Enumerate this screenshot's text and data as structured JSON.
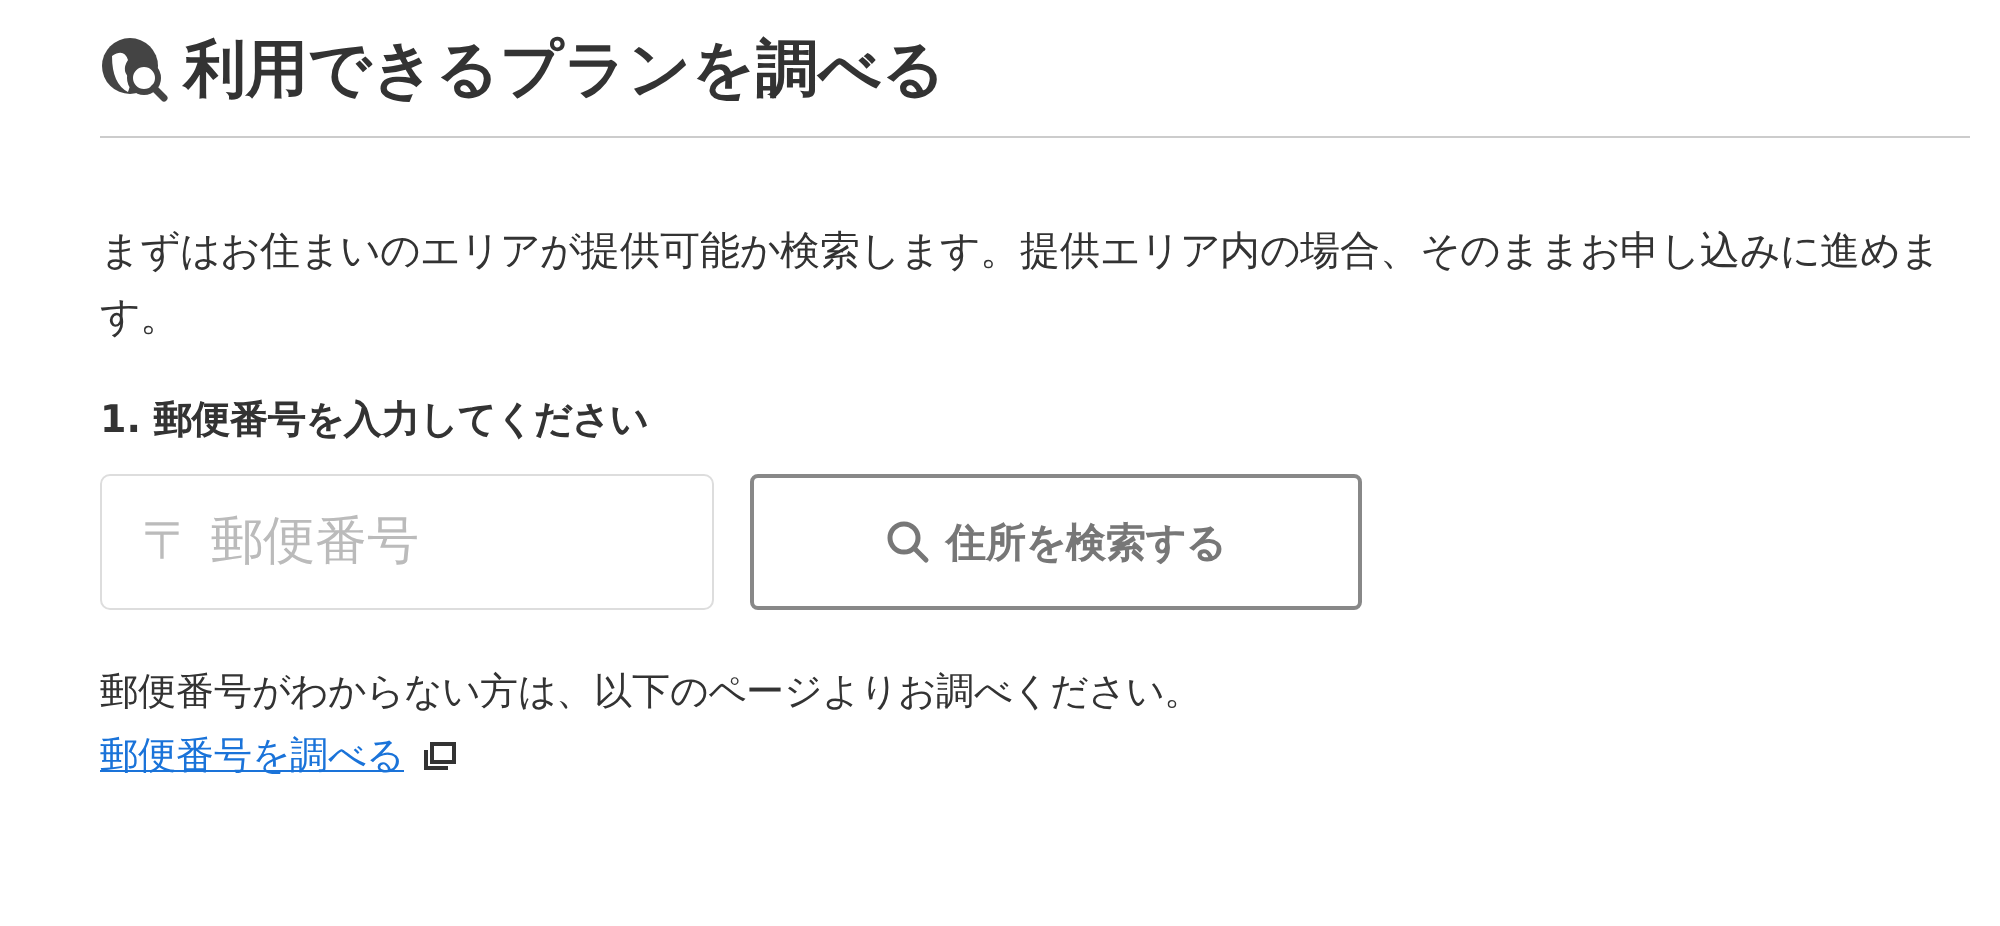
{
  "title": "利用できるプランを調べる",
  "intro": "まずはお住まいのエリアが提供可能か検索します。提供エリア内の場合、そのままお申し込みに進めます。",
  "step_label": "1. 郵便番号を入力してください",
  "postal_field": {
    "placeholder": "〒 郵便番号"
  },
  "search_button": "住所を検索する",
  "note": "郵便番号がわからない方は、以下のページよりお調べください。",
  "link": {
    "label": "郵便番号を調べる",
    "opens_new_window": true
  }
}
